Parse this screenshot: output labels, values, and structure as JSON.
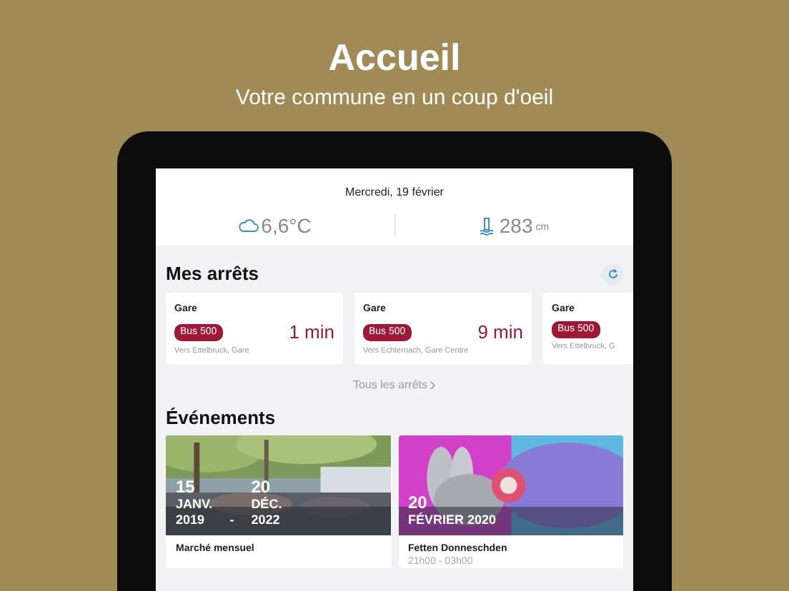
{
  "header": {
    "title": "Accueil",
    "subtitle": "Votre commune en un coup d'oeil"
  },
  "date": "Mercredi, 19 février",
  "weather": {
    "temperature": "6,6°C"
  },
  "water_level": {
    "value": "283",
    "unit": "cm"
  },
  "stops_section": {
    "title": "Mes arrêts",
    "link": "Tous les arrêts"
  },
  "stops": [
    {
      "name": "Gare",
      "line": "Bus 500",
      "time": "1 min",
      "direction": "Vers Ettelbruck, Gare"
    },
    {
      "name": "Gare",
      "line": "Bus 500",
      "time": "9 min",
      "direction": "Vers Echternach, Gare Centre"
    },
    {
      "name": "Gare",
      "line": "Bus 500",
      "direction": "Vers Ettelbruck, G"
    }
  ],
  "events_section": {
    "title": "Événements"
  },
  "events": [
    {
      "kind": "range",
      "start_day": "15",
      "start_month": "JANV.",
      "start_year": "2019",
      "separator": "-",
      "end_day": "20",
      "end_month": "DÉC.",
      "end_year": "2022",
      "title": "Marché mensuel"
    },
    {
      "kind": "single",
      "day": "20",
      "month_year": "FÉVRIER 2020",
      "title": "Fetten Donneschden",
      "time": "21h00 - 03h00"
    }
  ]
}
